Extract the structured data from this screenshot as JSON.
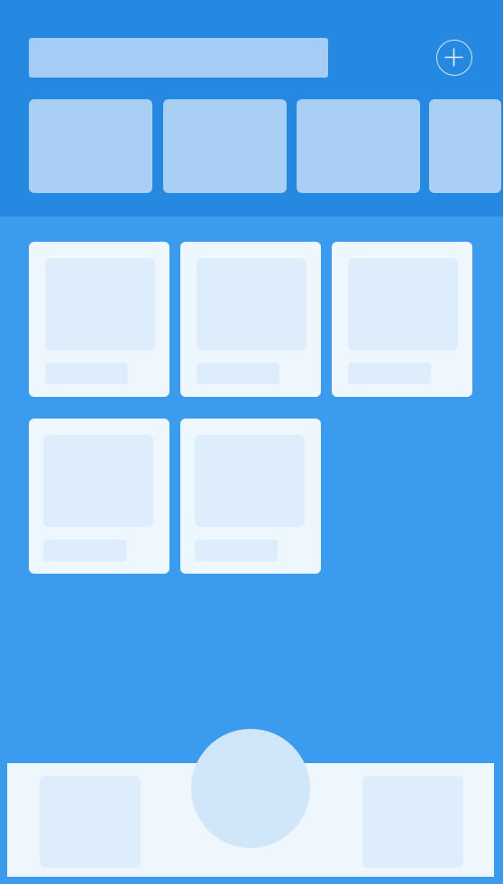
{
  "theme": {
    "background": "#3b9bef",
    "header_background": "#2589e2",
    "placeholder_light": "#a9cff4",
    "card_background": "#eef6fe",
    "card_inner": "#deedfb",
    "fab_color": "#d0e6f9"
  },
  "header": {
    "search_placeholder": "",
    "add_icon": "plus-circle-icon",
    "category_tiles": [
      "",
      "",
      "",
      ""
    ]
  },
  "grid": {
    "cards": [
      {
        "caption": ""
      },
      {
        "caption": ""
      },
      {
        "caption": ""
      },
      {
        "caption": ""
      },
      {
        "caption": ""
      }
    ]
  },
  "bottom_nav": {
    "slots": [
      "",
      ""
    ],
    "fab_label": ""
  }
}
